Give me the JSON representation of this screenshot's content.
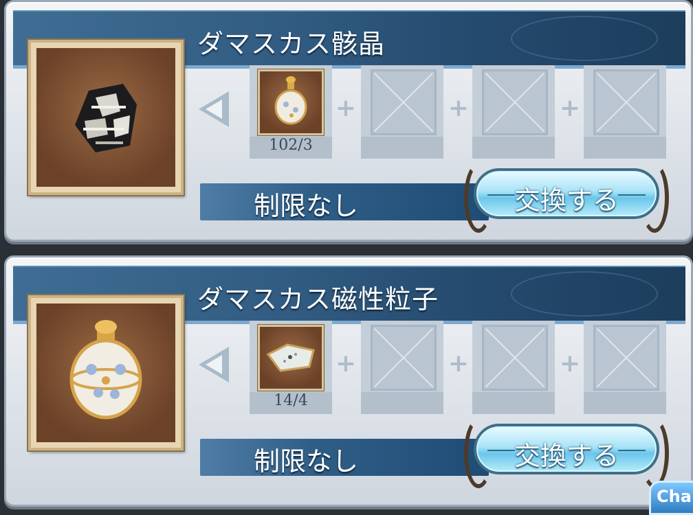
{
  "entries": [
    {
      "title": "ダマスカス骸晶",
      "item_icon": "damascus-crystal-icon",
      "ingredients": [
        {
          "icon": "damascus-grain-icon",
          "count": "102/3"
        },
        {
          "icon": "empty-slot-icon",
          "count": ""
        },
        {
          "icon": "empty-slot-icon",
          "count": ""
        },
        {
          "icon": "empty-slot-icon",
          "count": ""
        }
      ],
      "limit": "制限なし",
      "exchange_label": "交換する"
    },
    {
      "title": "ダマスカス磁性粒子",
      "item_icon": "damascus-grain-icon",
      "ingredients": [
        {
          "icon": "spectral-dust-icon",
          "count": "14/4"
        },
        {
          "icon": "empty-slot-icon",
          "count": ""
        },
        {
          "icon": "empty-slot-icon",
          "count": ""
        },
        {
          "icon": "empty-slot-icon",
          "count": ""
        }
      ],
      "limit": "制限なし",
      "exchange_label": "交換する"
    }
  ],
  "chat_tab": "Cha"
}
